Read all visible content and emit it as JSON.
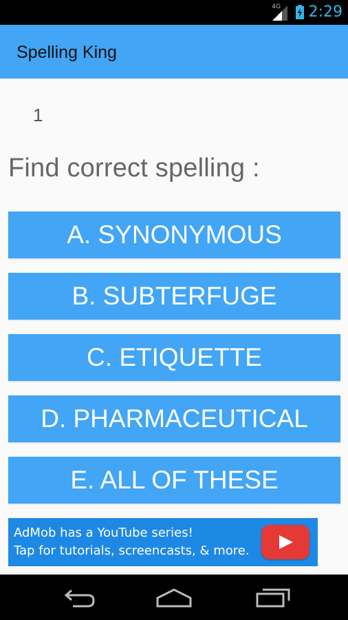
{
  "status_bar": {
    "time": "2:29",
    "network_label": "4G"
  },
  "action_bar": {
    "title": "Spelling King"
  },
  "quiz": {
    "question_number": "1",
    "prompt": "Find correct spelling :",
    "options": [
      "A. SYNONYMOUS",
      "B. SUBTERFUGE",
      "C. ETIQUETTE",
      "D. PHARMACEUTICAL",
      "E. ALL OF THESE"
    ]
  },
  "ad_banner": {
    "line1": "AdMob has a YouTube series!",
    "line2": "Tap for tutorials, screencasts, & more.",
    "icon": "youtube-play-icon"
  },
  "nav_bar": {
    "icons": [
      "back-icon",
      "home-icon",
      "recents-icon"
    ]
  },
  "colors": {
    "accent": "#42a5f5",
    "ad_background": "#1e88e5",
    "clock": "#33b5e5",
    "youtube_red": "#e53935"
  }
}
